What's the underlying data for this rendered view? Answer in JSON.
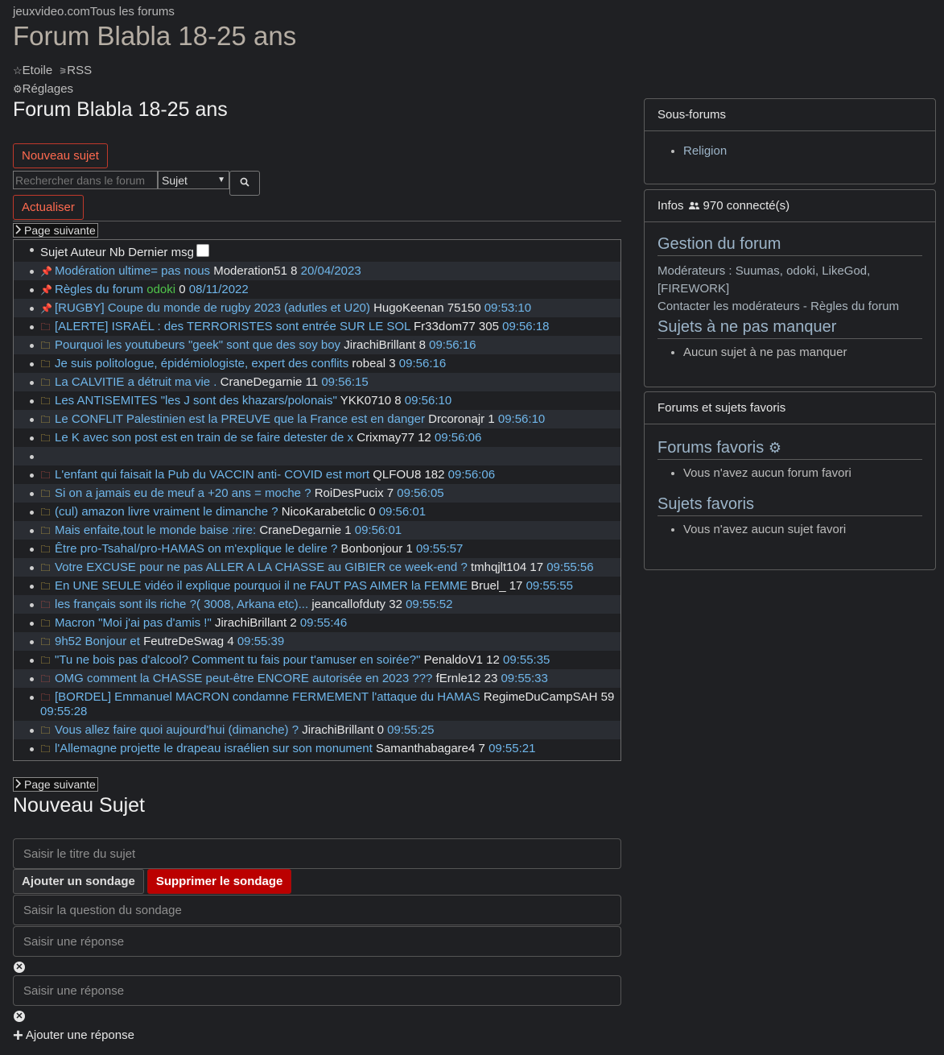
{
  "breadcrumb": {
    "site": "jeuxvideo.com",
    "all_forums": "Tous les forums"
  },
  "page_title": "Forum Blabla 18-25 ans",
  "meta": {
    "star": "Etoile",
    "rss": "RSS",
    "settings": "Réglages"
  },
  "forum_title": "Forum Blabla 18-25 ans",
  "buttons": {
    "new_topic": "Nouveau sujet",
    "refresh": "Actualiser",
    "next_page": "Page suivante"
  },
  "search": {
    "placeholder": "Rechercher dans le forum",
    "select_value": "Sujet"
  },
  "table_header": "Sujet Auteur Nb Dernier msg",
  "topics": [
    {
      "icon": "pin-red",
      "title": "Modération ultime= pas nous",
      "author": "Moderation51",
      "count": "8",
      "date": "20/04/2023",
      "author_green": false
    },
    {
      "icon": "pin-red",
      "title": "Règles du forum",
      "author": "odoki",
      "count": "0",
      "date": "08/11/2022",
      "author_green": true
    },
    {
      "icon": "pin-yellow",
      "title": "[RUGBY] Coupe du monde de rugby 2023 (adutles et U20)",
      "author": "HugoKeenan",
      "count": "75150",
      "date": "09:53:10",
      "author_green": false
    },
    {
      "icon": "folder-red",
      "title": "[ALERTE] ISRAËL : des TERRORISTES sont entrée SUR LE SOL",
      "author": "Fr33dom77",
      "count": "305",
      "date": "09:56:18",
      "author_green": false
    },
    {
      "icon": "folder-yellow",
      "title": "Pourquoi les youtubeurs \"geek\" sont que des soy boy",
      "author": "JirachiBrillant",
      "count": "8",
      "date": "09:56:16",
      "author_green": false
    },
    {
      "icon": "folder-yellow",
      "title": "Je suis politologue, épidémiologiste, expert des conflits",
      "author": "robeal",
      "count": "3",
      "date": "09:56:16",
      "author_green": false
    },
    {
      "icon": "folder-yellow",
      "title": "La CALVITIE a détruit ma vie .",
      "author": "CraneDegarnie",
      "count": "11",
      "date": "09:56:15",
      "author_green": false
    },
    {
      "icon": "folder-yellow",
      "title": "Les ANTISEMITES \"les J sont des khazars/polonais\"",
      "author": "YKK0710",
      "count": "8",
      "date": "09:56:10",
      "author_green": false
    },
    {
      "icon": "folder-yellow",
      "title": "Le CONFLIT Palestinien est la PREUVE que la France est en danger",
      "author": "Drcoronajr",
      "count": "1",
      "date": "09:56:10",
      "author_green": false
    },
    {
      "icon": "folder-yellow",
      "title": "Le K avec son post est en train de se faire detester de x",
      "author": "Crixmay77",
      "count": "12",
      "date": "09:56:06",
      "author_green": false
    },
    {
      "icon": "none",
      "title": "",
      "author": "",
      "count": "",
      "date": "",
      "author_green": false
    },
    {
      "icon": "folder-red",
      "title": "L'enfant qui faisait la Pub du VACCIN anti- COVID est mort",
      "author": "QLFOU8",
      "count": "182",
      "date": "09:56:06",
      "author_green": false
    },
    {
      "icon": "folder-yellow",
      "title": "Si on a jamais eu de meuf a +20 ans = moche ?",
      "author": "RoiDesPucix",
      "count": "7",
      "date": "09:56:05",
      "author_green": false
    },
    {
      "icon": "folder-yellow",
      "title": "(cul) amazon livre vraiment le dimanche ?",
      "author": "NicoKarabetclic",
      "count": "0",
      "date": "09:56:01",
      "author_green": false
    },
    {
      "icon": "folder-yellow",
      "title": "Mais enfaite,tout le monde baise :rire:",
      "author": "CraneDegarnie",
      "count": "1",
      "date": "09:56:01",
      "author_green": false
    },
    {
      "icon": "folder-yellow",
      "title": "Être pro-Tsahal/pro-HAMAS on m'explique le delire ?",
      "author": "Bonbonjour",
      "count": "1",
      "date": "09:55:57",
      "author_green": false
    },
    {
      "icon": "folder-yellow",
      "title": "Votre EXCUSE pour ne pas ALLER A LA CHASSE au GIBIER ce week-end ?",
      "author": "tmhqjlt104",
      "count": "17",
      "date": "09:55:56",
      "author_green": false
    },
    {
      "icon": "folder-yellow",
      "title": "En UNE SEULE vidéo il explique pourquoi il ne FAUT PAS AIMER la FEMME",
      "author": "Bruel_",
      "count": "17",
      "date": "09:55:55",
      "author_green": false
    },
    {
      "icon": "folder-red",
      "title": "les français sont ils riche ?( 3008, Arkana etc)...",
      "author": "jeancallofduty",
      "count": "32",
      "date": "09:55:52",
      "author_green": false
    },
    {
      "icon": "folder-yellow",
      "title": "Macron \"Moi j'ai pas d'amis !\"",
      "author": "JirachiBrillant",
      "count": "2",
      "date": "09:55:46",
      "author_green": false
    },
    {
      "icon": "folder-yellow",
      "title": "9h52 Bonjour et",
      "author": "FeutreDeSwag",
      "count": "4",
      "date": "09:55:39",
      "author_green": false
    },
    {
      "icon": "folder-yellow",
      "title": "\"Tu ne bois pas d'alcool? Comment tu fais pour t'amuser en soirée?\"",
      "author": "PenaldoV1",
      "count": "12",
      "date": "09:55:35",
      "author_green": false
    },
    {
      "icon": "folder-red",
      "title": "OMG comment la CHASSE peut-être ENCORE autorisée en 2023 ???",
      "author": "fErnle12",
      "count": "23",
      "date": "09:55:33",
      "author_green": false
    },
    {
      "icon": "folder-red",
      "title": "[BORDEL] Emmanuel MACRON condamne FERMEMENT l'attaque du HAMAS",
      "author": "RegimeDuCampSAH",
      "count": "59",
      "date": "09:55:28",
      "author_green": false
    },
    {
      "icon": "folder-yellow",
      "title": "Vous allez faire quoi aujourd'hui (dimanche) ?",
      "author": "JirachiBrillant",
      "count": "0",
      "date": "09:55:25",
      "author_green": false
    },
    {
      "icon": "folder-yellow",
      "title": "l'Allemagne projette le drapeau israélien sur son monument",
      "author": "Samanthabagare4",
      "count": "7",
      "date": "09:55:21",
      "author_green": false
    }
  ],
  "new_topic_form": {
    "heading": "Nouveau Sujet",
    "title_placeholder": "Saisir le titre du sujet",
    "add_poll": "Ajouter un sondage",
    "remove_poll": "Supprimer le sondage",
    "poll_question_placeholder": "Saisir la question du sondage",
    "answer_placeholder_1": "Saisir une réponse",
    "answer_placeholder_2": "Saisir une réponse",
    "add_answer": "Ajouter une réponse"
  },
  "sidebar": {
    "subforums": {
      "header": "Sous-forums",
      "items": [
        "Religion"
      ]
    },
    "infos": {
      "header": "Infos",
      "connected": "970 connecté(s)",
      "management_title": "Gestion du forum",
      "moderators_label": "Modérateurs :",
      "moderators": "Suumas, odoki, LikeGod, [FIREWORK]",
      "contact_mods": "Contacter les modérateurs",
      "separator": "-",
      "rules": "Règles du forum",
      "must_see_title": "Sujets à ne pas manquer",
      "must_see_empty": "Aucun sujet à ne pas manquer"
    },
    "favorites": {
      "header": "Forums et sujets favoris",
      "forums_title": "Forums favoris",
      "forums_empty": "Vous n'avez aucun forum favori",
      "topics_title": "Sujets favoris",
      "topics_empty": "Vous n'avez aucun sujet favori"
    }
  },
  "colors": {
    "background": "#1f2023",
    "link": "#6fb6ea",
    "danger": "#bb0000",
    "accent_red": "#ff6a4f"
  }
}
